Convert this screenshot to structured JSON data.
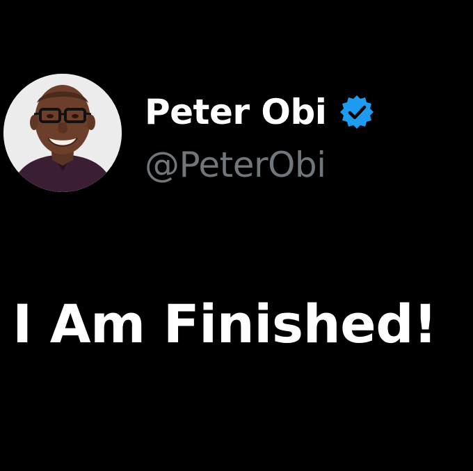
{
  "profile": {
    "display_name": "Peter Obi",
    "handle": "@PeterObi",
    "verified": true,
    "avatar_icon": "profile-photo",
    "verified_icon": "verified-badge-icon"
  },
  "tweet": {
    "text": "I Am Finished!"
  },
  "colors": {
    "background": "#000000",
    "name": "#ffffff",
    "handle": "#71767b",
    "verified_badge": "#1d9bf0",
    "tweet_text": "#ffffff"
  }
}
